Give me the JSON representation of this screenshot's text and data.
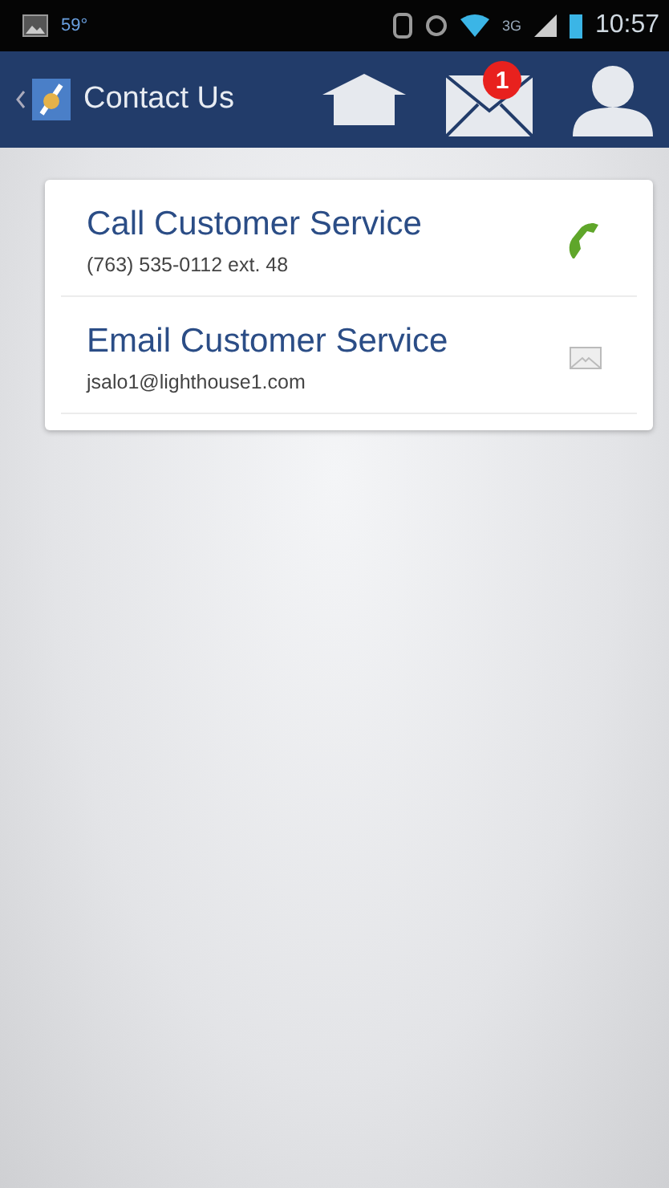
{
  "status_bar": {
    "temperature": "59°",
    "network": "3G",
    "time": "10:57"
  },
  "app_bar": {
    "title": "Contact Us",
    "mail_badge": "1"
  },
  "contacts": [
    {
      "kind": "phone",
      "title": "Call Customer Service",
      "detail": "(763) 535-0112 ext. 48"
    },
    {
      "kind": "email",
      "title": "Email Customer Service",
      "detail": "jsalo1@lighthouse1.com"
    }
  ]
}
